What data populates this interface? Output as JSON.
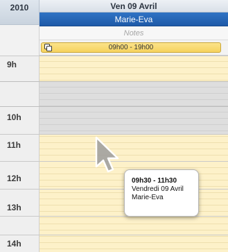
{
  "header": {
    "year": "2010",
    "day_label": "Ven 09 Avril",
    "person": "Marie-Eva",
    "notes_placeholder": "Notes"
  },
  "shift": {
    "label": "09h00 - 19h00",
    "icon": "copy-icon"
  },
  "hours": [
    "9h",
    "10h",
    "11h",
    "12h",
    "13h",
    "14h"
  ],
  "tooltip": {
    "time": "09h30 - 11h30",
    "date": "Vendredi 09 Avril",
    "person": "Marie-Eva"
  },
  "colors": {
    "person_header": "#1e5aa8",
    "shift_bar": "#f6d25e",
    "day_background": "#fdf1c9",
    "busy_block": "#dedede"
  }
}
